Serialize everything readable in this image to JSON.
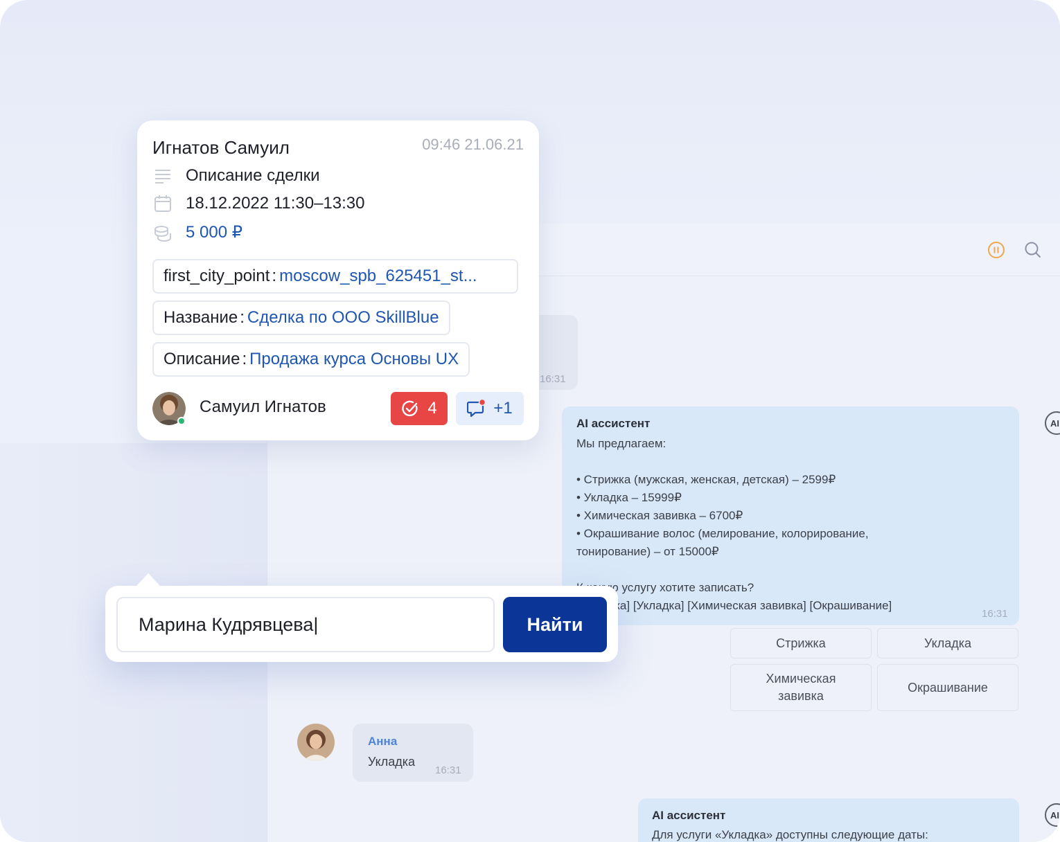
{
  "deal_card": {
    "name": "Игнатов Самуил",
    "datetime": "09:46 21.06.21",
    "description_label": "Описание сделки",
    "period": "18.12.2022 11:30–13:30",
    "amount": "5 000 ₽",
    "fields": [
      {
        "key": "first_city_point",
        "value": "moscow_spb_625451_st..."
      },
      {
        "key": "Название",
        "value": "Сделка по ООО SkillBlue"
      },
      {
        "key": "Описание",
        "value": "Продажа курса Основы UX"
      }
    ],
    "owner": "Самуил Игнатов",
    "tasks_count": "4",
    "comments_count": "+1"
  },
  "search": {
    "value": "Марина Кудрявцева|",
    "button_label": "Найти"
  },
  "chat": {
    "first_msg_time": "16:31",
    "ai_msg1": {
      "author": "AI ассистент",
      "lines": [
        "Мы предлагаем:",
        "",
        "• Стрижка (мужская, женская, детская) – 2599₽",
        "• Укладка – 15999₽",
        "• Химическая завивка – 6700₽",
        "• Окрашивание волос (мелирование, колорирование,",
        "тонирование) – от 15000₽",
        "",
        "К какую услугу хотите записать?",
        "[Стрижка] [Укладка] [Химическая завивка] [Окрашивание]"
      ],
      "time": "16:31"
    },
    "quick_replies": [
      "Стрижка",
      "Укладка",
      "Химическая завивка",
      "Окрашивание"
    ],
    "user_msg": {
      "author": "Анна",
      "text": "Укладка",
      "time": "16:31"
    },
    "ai_msg2": {
      "author": "AI ассистент",
      "text": "Для услуги «Укладка» доступны следующие даты:"
    },
    "ai_badge_label": "AI"
  },
  "colors": {
    "accent_blue": "#0b3596",
    "link_blue": "#1f56b0",
    "task_red": "#e84545",
    "pause_orange": "#f0a64a",
    "online_green": "#2bb673"
  }
}
